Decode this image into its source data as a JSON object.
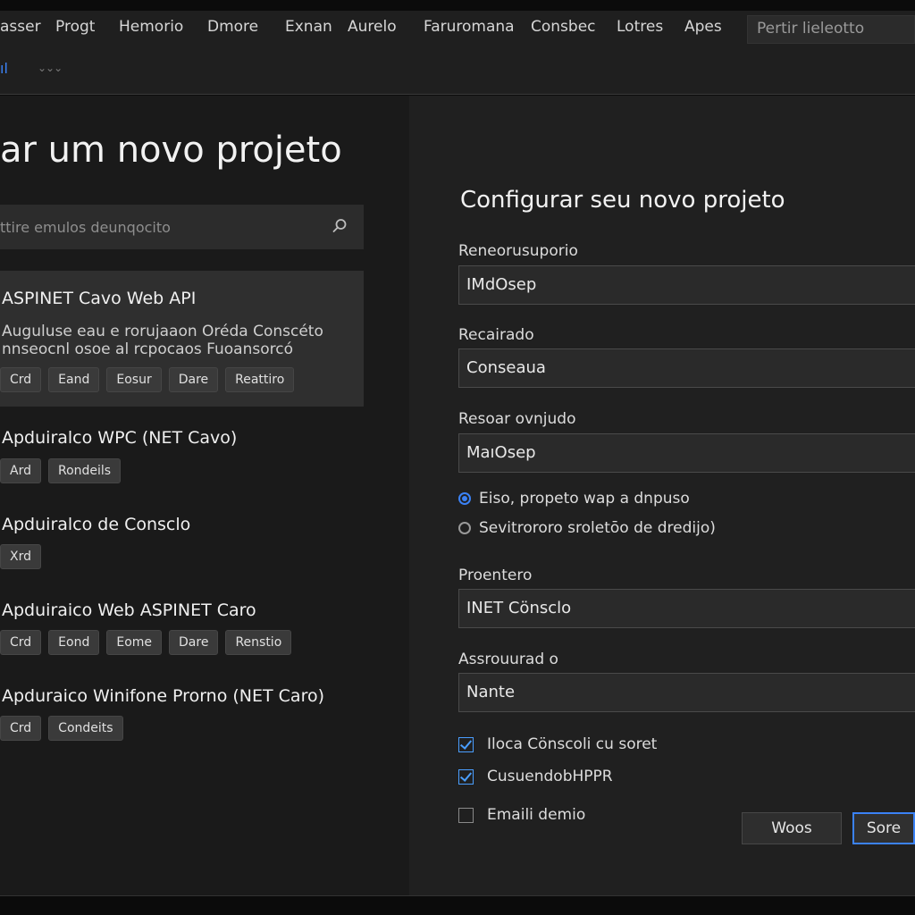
{
  "menu": {
    "items": [
      "asser",
      "Progt",
      "Hemorio",
      "Dmore",
      "Exnan",
      "Aurelo",
      "Faruromana",
      "Consbec",
      "Lotres",
      "Apes"
    ],
    "search_placeholder": "Pertir lieleotto"
  },
  "toolbar": {
    "chevrons": "⌄⌄⌄"
  },
  "left": {
    "title": "ar um novo projeto",
    "search_placeholder": "ttire emulos deunqocito",
    "templates": [
      {
        "name": "ASPINET Cavo Web API",
        "description": [
          "Auguluse eau e rorujaaon Oréda Conscéto",
          "nnseocnl osoe al rcpocaos Fuoansorcó"
        ],
        "tags": [
          "Crd",
          "Eand",
          "Eosur",
          "Dare",
          "Reattiro"
        ],
        "selected": true
      },
      {
        "name": "Apduiralco WPC (NET Cavo)",
        "tags": [
          "Ard",
          "Rondeils"
        ]
      },
      {
        "name": "Apduiralco de Consclo",
        "tags": [
          "Xrd"
        ]
      },
      {
        "name": "Apduiraico Web ASPINET Caro",
        "tags": [
          "Crd",
          "Eond",
          "Eome",
          "Dare",
          "Renstio"
        ]
      },
      {
        "name": "Apduraico Winifone Prorno (NET Caro)",
        "tags": [
          "Crd",
          "Condeits"
        ]
      }
    ]
  },
  "right": {
    "title": "Configurar seu novo projeto",
    "fields": [
      {
        "label": "Reneorusuporio",
        "value": "IMdOsep"
      },
      {
        "label": "Recairado",
        "value": "Conseaua"
      },
      {
        "label": "Resoar ovnjudo",
        "value": "MaıOsep"
      }
    ],
    "radios": [
      {
        "label": "Eiso, propeto wap a dnpuso",
        "selected": true
      },
      {
        "label": "Sevitrororo sroletōo de dredijo)",
        "selected": false
      }
    ],
    "fields2": [
      {
        "label": "Proentero",
        "value": "INET Cönsclo"
      },
      {
        "label": "Assrouurad o",
        "value": "Nante"
      }
    ],
    "checks": [
      {
        "label": "Iloca Cönscoli cu soret",
        "checked": true
      },
      {
        "label": "CusuendobHPPR",
        "checked": true
      },
      {
        "label": "Emaili demio",
        "checked": false
      }
    ],
    "buttons": {
      "secondary": "Woos",
      "primary": "Sore"
    }
  },
  "colors": {
    "accent": "#3b82f6",
    "background": "#1a1a1a",
    "panel": "#202020"
  },
  "icons": {
    "search": "search-icon",
    "brand": "blue-glyph-icon"
  }
}
